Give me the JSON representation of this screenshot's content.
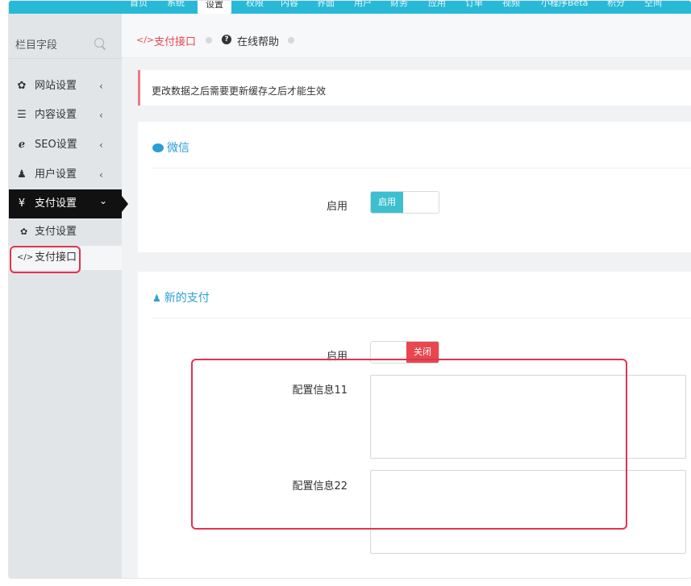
{
  "topnav": {
    "items": [
      "首页",
      "系统",
      "设置",
      "权限",
      "内容",
      "界面",
      "用户",
      "财务",
      "应用",
      "订单",
      "视频",
      "小程序Beta",
      "积分",
      "空间"
    ],
    "active": "设置"
  },
  "sidebar": {
    "search_label": "栏目字段",
    "items": [
      {
        "icon": "gear-icon",
        "glyph": "✿",
        "label": "网站设置",
        "chev": "‹"
      },
      {
        "icon": "list-icon",
        "glyph": "☰",
        "label": "内容设置",
        "chev": "‹"
      },
      {
        "icon": "ie-icon",
        "glyph": "ℯ",
        "label": "SEO设置",
        "chev": "‹"
      },
      {
        "icon": "user-icon",
        "glyph": "♟",
        "label": "用户设置",
        "chev": "‹"
      },
      {
        "icon": "yen-icon",
        "glyph": "¥",
        "label": "支付设置",
        "chev": "⌄"
      }
    ],
    "subitems": [
      {
        "icon": "gear-icon",
        "glyph": "✿",
        "label": "支付设置"
      },
      {
        "icon": "code-icon",
        "glyph": "</>",
        "label": "支付接口"
      }
    ]
  },
  "breadcrumb": {
    "current_icon": "</>",
    "current": "支付接口",
    "help_icon": "?",
    "help": "在线帮助"
  },
  "alert": {
    "text": "更改数据之后需要更新缓存之后才能生效"
  },
  "wechat_panel": {
    "icon": "wechat-icon",
    "title": "微信",
    "enable_label": "启用",
    "toggle_on_text": "启用"
  },
  "newpay_panel": {
    "icon": "user-icon",
    "title": "新的支付",
    "enable_label": "启用",
    "toggle_off_text": "关闭",
    "config1_label": "配置信息11",
    "config2_label": "配置信息22"
  },
  "colors": {
    "accent": "#28b9d7",
    "toggle_on": "#3cc0cf",
    "toggle_off": "#e8474f",
    "annotation": "#e0344d"
  }
}
